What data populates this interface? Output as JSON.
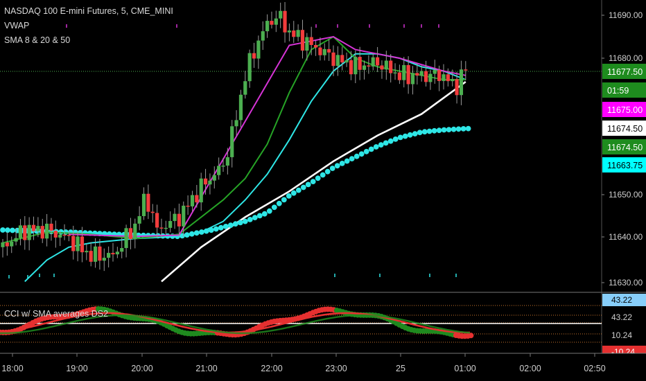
{
  "legend": {
    "symbol": "NASDAQ 100 E-mini Futures, 5, CME_MINI",
    "vwap": "VWAP",
    "sma": "SMA 8 & 20 & 50"
  },
  "sub_legend": "CCI w/ SMA averages DS2",
  "chart_data": [
    {
      "type": "candlestick",
      "title": "NASDAQ 100 E-mini Futures, 5, CME_MINI",
      "ylim": [
        11626,
        11693
      ],
      "y_ticks": [
        "11690.00",
        "11680.00",
        "11650.00",
        "11640.00",
        "11630.00"
      ],
      "x_ticks": [
        "18:00",
        "19:00",
        "20:00",
        "21:00",
        "22:00",
        "23:00",
        "25",
        "01:00",
        "02:00",
        "02:50"
      ],
      "series": [
        {
          "name": "VWAP",
          "color": "#2ee6e6",
          "style": "dots",
          "points": [
            [
              0,
              11640
            ],
            [
              30,
              11639.5
            ],
            [
              60,
              11638.8
            ],
            [
              80,
              11638.5
            ],
            [
              95,
              11640
            ],
            [
              110,
              11642
            ],
            [
              120,
              11644
            ],
            [
              130,
              11648
            ],
            [
              140,
              11651
            ],
            [
              150,
              11654.5
            ],
            [
              160,
              11657
            ],
            [
              170,
              11659.5
            ],
            [
              180,
              11661.5
            ],
            [
              190,
              11662.8
            ],
            [
              200,
              11663.3
            ],
            [
              210,
              11663.6
            ],
            [
              220,
              11663.75
            ]
          ]
        },
        {
          "name": "SMA 8",
          "color": "#26a326",
          "points": [
            [
              0,
              11637
            ],
            [
              20,
              11639.5
            ],
            [
              40,
              11639
            ],
            [
              60,
              11638
            ],
            [
              80,
              11639
            ],
            [
              90,
              11643
            ],
            [
              100,
              11647
            ],
            [
              110,
              11652
            ],
            [
              120,
              11660
            ],
            [
              130,
              11672
            ],
            [
              140,
              11682
            ],
            [
              150,
              11685
            ],
            [
              160,
              11680
            ],
            [
              170,
              11678
            ],
            [
              180,
              11677
            ],
            [
              190,
              11676
            ],
            [
              200,
              11675
            ],
            [
              210,
              11675
            ]
          ]
        },
        {
          "name": "SMA 20",
          "color": "#2ee6e6",
          "points": [
            [
              10,
              11628
            ],
            [
              20,
              11633
            ],
            [
              30,
              11636
            ],
            [
              40,
              11637
            ],
            [
              60,
              11638
            ],
            [
              80,
              11638.5
            ],
            [
              90,
              11639.5
            ],
            [
              100,
              11642
            ],
            [
              110,
              11647
            ],
            [
              120,
              11653
            ],
            [
              130,
              11661
            ],
            [
              140,
              11670
            ],
            [
              150,
              11677
            ],
            [
              160,
              11681
            ],
            [
              170,
              11681
            ],
            [
              180,
              11680
            ],
            [
              190,
              11678
            ],
            [
              200,
              11677
            ],
            [
              210,
              11675
            ]
          ]
        },
        {
          "name": "SMA 50",
          "color": "#ffffff",
          "points": [
            [
              72,
              11628
            ],
            [
              90,
              11636
            ],
            [
              110,
              11643
            ],
            [
              130,
              11649
            ],
            [
              150,
              11656
            ],
            [
              170,
              11662
            ],
            [
              190,
              11667
            ],
            [
              210,
              11674.5
            ]
          ]
        },
        {
          "name": "VWAP line",
          "color": "#d633d6",
          "points": [
            [
              30,
              11639
            ],
            [
              60,
              11638.5
            ],
            [
              80,
              11638.8
            ],
            [
              130,
              11683
            ],
            [
              150,
              11685
            ],
            [
              160,
              11682
            ],
            [
              170,
              11681
            ],
            [
              180,
              11680
            ],
            [
              200,
              11677
            ],
            [
              210,
              11676
            ]
          ]
        }
      ],
      "price_labels": [
        {
          "text": "11677.50",
          "bg": "#1e8c1e",
          "fg": "#ffffff",
          "value": 11677.5
        },
        {
          "text": "01:59",
          "bg": "#1e8c1e",
          "fg": "#ffffff",
          "value": 11676.0
        },
        {
          "text": "11675.00",
          "bg": "#ff00ff",
          "fg": "#ffffff",
          "value": 11671.2
        },
        {
          "text": "11674.50",
          "bg": "#ffffff",
          "fg": "#000000",
          "value": 11668.2
        },
        {
          "text": "11674.50",
          "bg": "#1e8c1e",
          "fg": "#ffffff",
          "value": 11665.2
        },
        {
          "text": "11663.75",
          "bg": "#00ffff",
          "fg": "#000000",
          "value": 11662.2
        }
      ],
      "last_price": 11677.5
    },
    {
      "type": "line",
      "title": "CCI w/ SMA averages DS2",
      "y_ticks": [
        "43.22",
        "43.22",
        "10.24"
      ],
      "partial_label": "-10.24"
    }
  ]
}
